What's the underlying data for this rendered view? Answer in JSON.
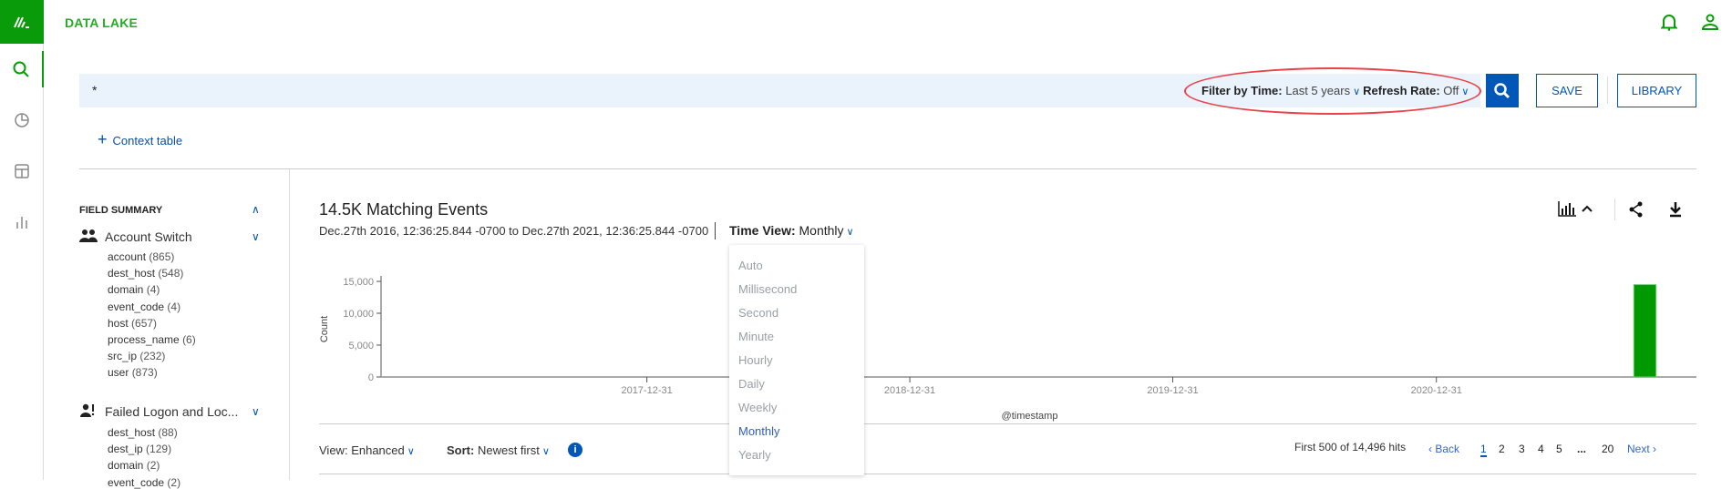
{
  "app": {
    "title": "DATA LAKE",
    "accent": "#0a9b0a",
    "primary": "#0057b8"
  },
  "nav": {
    "items": [
      {
        "icon": "search-icon",
        "active": true
      },
      {
        "icon": "pie-chart-icon"
      },
      {
        "icon": "layout-icon"
      },
      {
        "icon": "bar-chart-icon"
      }
    ]
  },
  "header": {
    "icons": [
      "bell-icon",
      "user-icon"
    ]
  },
  "search": {
    "query": "*",
    "filter_label": "Filter by Time:",
    "filter_value": "Last 5 years",
    "refresh_label": "Refresh Rate:",
    "refresh_value": "Off",
    "save_label": "SAVE",
    "library_label": "LIBRARY",
    "context_table_label": "Context table"
  },
  "field_summary": {
    "title": "FIELD SUMMARY",
    "groups": [
      {
        "name": "Account Switch",
        "icon": "users-icon",
        "fields": [
          {
            "name": "account",
            "count": "(865)"
          },
          {
            "name": "dest_host",
            "count": "(548)"
          },
          {
            "name": "domain",
            "count": "(4)"
          },
          {
            "name": "event_code",
            "count": "(4)"
          },
          {
            "name": "host",
            "count": "(657)"
          },
          {
            "name": "process_name",
            "count": "(6)"
          },
          {
            "name": "src_ip",
            "count": "(232)"
          },
          {
            "name": "user",
            "count": "(873)"
          }
        ]
      },
      {
        "name": "Failed Logon and Loc...",
        "icon": "user-alert-icon",
        "fields": [
          {
            "name": "dest_host",
            "count": "(88)"
          },
          {
            "name": "dest_ip",
            "count": "(129)"
          },
          {
            "name": "domain",
            "count": "(2)"
          },
          {
            "name": "event_code",
            "count": "(2)"
          }
        ]
      }
    ]
  },
  "results": {
    "title": "14.5K Matching Events",
    "range": "Dec.27th 2016, 12:36:25.844 -0700 to Dec.27th 2021, 12:36:25.844 -0700",
    "time_view_label": "Time View:",
    "time_view_value": "Monthly",
    "time_view_options": [
      "Auto",
      "Millisecond",
      "Second",
      "Minute",
      "Hourly",
      "Daily",
      "Weekly",
      "Monthly",
      "Yearly"
    ],
    "view_label": "View:",
    "view_value": "Enhanced",
    "sort_label": "Sort:",
    "sort_value": "Newest first",
    "hits": "First 500 of 14,496 hits",
    "back": "Back",
    "next": "Next",
    "pages": [
      "1",
      "2",
      "3",
      "4",
      "5",
      "...",
      "20"
    ],
    "current_page": "1"
  },
  "chart_data": {
    "type": "bar",
    "xlabel": "@timestamp",
    "ylabel": "Count",
    "xlim": [
      "2016-12-27",
      "2021-12-27"
    ],
    "ylim": [
      0,
      15000
    ],
    "yticks": [
      {
        "v": 0,
        "label": "0"
      },
      {
        "v": 5000,
        "label": "5,000"
      },
      {
        "v": 10000,
        "label": "10,000"
      },
      {
        "v": 15000,
        "label": "15,000"
      }
    ],
    "xticks": [
      "2017-12-31",
      "2018-12-31",
      "2019-12-31",
      "2020-12-31"
    ],
    "bars": [
      {
        "x": "2021-10",
        "y": 14496
      }
    ],
    "bar_color": "#009900",
    "grid": false
  }
}
